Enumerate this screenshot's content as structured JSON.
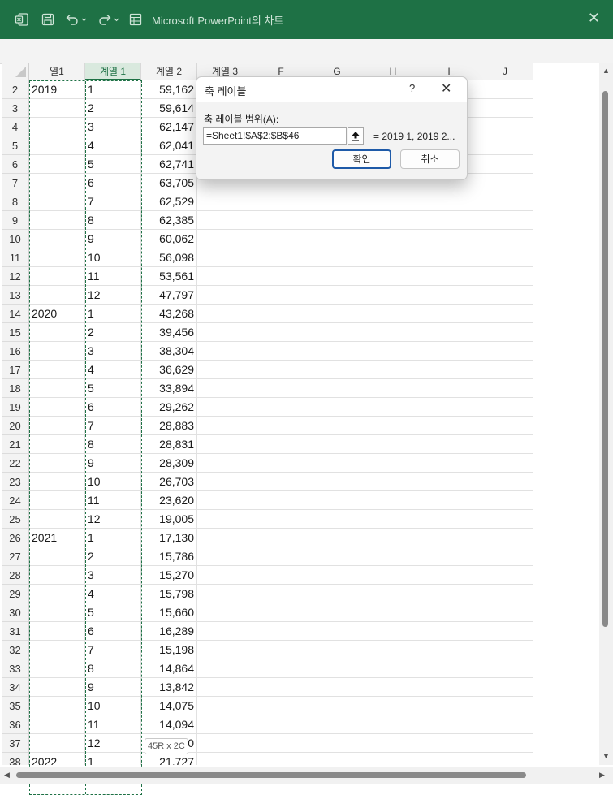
{
  "window": {
    "title": "Microsoft PowerPoint의 차트",
    "accent": "#1e7145"
  },
  "toolbar": {
    "icons": [
      "excel-icon",
      "save-icon",
      "undo-icon",
      "redo-icon",
      "table-icon"
    ]
  },
  "columns": [
    {
      "label": "열1",
      "selected": false
    },
    {
      "label": "계열 1",
      "selected": true
    },
    {
      "label": "계열 2",
      "selected": false
    },
    {
      "label": "계열 3",
      "selected": false
    },
    {
      "label": "F",
      "selected": false
    },
    {
      "label": "G",
      "selected": false
    },
    {
      "label": "H",
      "selected": false
    },
    {
      "label": "I",
      "selected": false
    },
    {
      "label": "J",
      "selected": false
    }
  ],
  "rows": [
    {
      "num": "2",
      "year": "2019",
      "month": "1",
      "value": "59,162"
    },
    {
      "num": "3",
      "year": "",
      "month": "2",
      "value": "59,614"
    },
    {
      "num": "4",
      "year": "",
      "month": "3",
      "value": "62,147"
    },
    {
      "num": "5",
      "year": "",
      "month": "4",
      "value": "62,041"
    },
    {
      "num": "6",
      "year": "",
      "month": "5",
      "value": "62,741"
    },
    {
      "num": "7",
      "year": "",
      "month": "6",
      "value": "63,705"
    },
    {
      "num": "8",
      "year": "",
      "month": "7",
      "value": "62,529"
    },
    {
      "num": "9",
      "year": "",
      "month": "8",
      "value": "62,385"
    },
    {
      "num": "10",
      "year": "",
      "month": "9",
      "value": "60,062"
    },
    {
      "num": "11",
      "year": "",
      "month": "10",
      "value": "56,098"
    },
    {
      "num": "12",
      "year": "",
      "month": "11",
      "value": "53,561"
    },
    {
      "num": "13",
      "year": "",
      "month": "12",
      "value": "47,797"
    },
    {
      "num": "14",
      "year": "2020",
      "month": "1",
      "value": "43,268"
    },
    {
      "num": "15",
      "year": "",
      "month": "2",
      "value": "39,456"
    },
    {
      "num": "16",
      "year": "",
      "month": "3",
      "value": "38,304"
    },
    {
      "num": "17",
      "year": "",
      "month": "4",
      "value": "36,629"
    },
    {
      "num": "18",
      "year": "",
      "month": "5",
      "value": "33,894"
    },
    {
      "num": "19",
      "year": "",
      "month": "6",
      "value": "29,262"
    },
    {
      "num": "20",
      "year": "",
      "month": "7",
      "value": "28,883"
    },
    {
      "num": "21",
      "year": "",
      "month": "8",
      "value": "28,831"
    },
    {
      "num": "22",
      "year": "",
      "month": "9",
      "value": "28,309"
    },
    {
      "num": "23",
      "year": "",
      "month": "10",
      "value": "26,703"
    },
    {
      "num": "24",
      "year": "",
      "month": "11",
      "value": "23,620"
    },
    {
      "num": "25",
      "year": "",
      "month": "12",
      "value": "19,005"
    },
    {
      "num": "26",
      "year": "2021",
      "month": "1",
      "value": "17,130"
    },
    {
      "num": "27",
      "year": "",
      "month": "2",
      "value": "15,786"
    },
    {
      "num": "28",
      "year": "",
      "month": "3",
      "value": "15,270"
    },
    {
      "num": "29",
      "year": "",
      "month": "4",
      "value": "15,798"
    },
    {
      "num": "30",
      "year": "",
      "month": "5",
      "value": "15,660"
    },
    {
      "num": "31",
      "year": "",
      "month": "6",
      "value": "16,289"
    },
    {
      "num": "32",
      "year": "",
      "month": "7",
      "value": "15,198"
    },
    {
      "num": "33",
      "year": "",
      "month": "8",
      "value": "14,864"
    },
    {
      "num": "34",
      "year": "",
      "month": "9",
      "value": "13,842"
    },
    {
      "num": "35",
      "year": "",
      "month": "10",
      "value": "14,075"
    },
    {
      "num": "36",
      "year": "",
      "month": "11",
      "value": "14,094"
    },
    {
      "num": "37",
      "year": "",
      "month": "12",
      "value": "0"
    },
    {
      "num": "38",
      "year": "2022",
      "month": "1",
      "value": "21,727"
    }
  ],
  "selection": {
    "size_tip": "45R x 2C"
  },
  "dialog": {
    "title": "축 레이블",
    "help": "?",
    "range_label": "축 레이블 범위(A):",
    "range_value": "=Sheet1!$A$2:$B$46",
    "preview": "= 2019 1, 2019 2...",
    "ok_label": "확인",
    "cancel_label": "취소"
  }
}
